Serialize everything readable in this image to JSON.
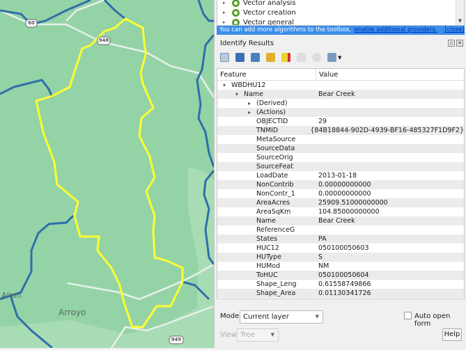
{
  "map": {
    "place_labels": [
      "Alton",
      "Arroyo"
    ],
    "road_shields": [
      "60",
      "948",
      "949"
    ],
    "colors": {
      "land": "#94d3a6",
      "boundary": "#ffff33",
      "river": "#2f6ea8",
      "road": "#e8f0ea"
    }
  },
  "toolbox": {
    "items": [
      "Vector analysis",
      "Vector creation",
      "Vector general"
    ],
    "banner_text": "You can add more algorithms to the toolbox,",
    "banner_link": "enable additional providers.",
    "banner_close": "[close]"
  },
  "identify": {
    "title": "Identify Results",
    "columns": [
      "Feature",
      "Value"
    ],
    "rows": [
      {
        "f": "WBDHU12",
        "v": "",
        "lvl": 0,
        "exp": "▾"
      },
      {
        "f": "Name",
        "v": "Bear Creek",
        "lvl": 1,
        "exp": "▾"
      },
      {
        "f": "(Derived)",
        "v": "",
        "lvl": 2,
        "exp": "▸"
      },
      {
        "f": "(Actions)",
        "v": "",
        "lvl": 2,
        "exp": "▸"
      },
      {
        "f": "OBJECTID",
        "v": "29",
        "lvl": 2,
        "exp": ""
      },
      {
        "f": "TNMID",
        "v": "{84B18844-902D-4939-BF16-485327F1D9F2}",
        "lvl": 2,
        "exp": ""
      },
      {
        "f": "MetaSource",
        "v": "",
        "lvl": 2,
        "exp": ""
      },
      {
        "f": "SourceData",
        "v": "",
        "lvl": 2,
        "exp": ""
      },
      {
        "f": "SourceOrig",
        "v": "",
        "lvl": 2,
        "exp": ""
      },
      {
        "f": "SourceFeat",
        "v": "",
        "lvl": 2,
        "exp": ""
      },
      {
        "f": "LoadDate",
        "v": "2013-01-18",
        "lvl": 2,
        "exp": ""
      },
      {
        "f": "NonContrib",
        "v": "0.00000000000",
        "lvl": 2,
        "exp": ""
      },
      {
        "f": "NonContr_1",
        "v": "0.00000000000",
        "lvl": 2,
        "exp": ""
      },
      {
        "f": "AreaAcres",
        "v": "25909.51000000000",
        "lvl": 2,
        "exp": ""
      },
      {
        "f": "AreaSqKm",
        "v": "104.85000000000",
        "lvl": 2,
        "exp": ""
      },
      {
        "f": "Name",
        "v": "Bear Creek",
        "lvl": 2,
        "exp": ""
      },
      {
        "f": "ReferenceG",
        "v": "",
        "lvl": 2,
        "exp": ""
      },
      {
        "f": "States",
        "v": "PA",
        "lvl": 2,
        "exp": ""
      },
      {
        "f": "HUC12",
        "v": "050100050603",
        "lvl": 2,
        "exp": ""
      },
      {
        "f": "HUType",
        "v": "S",
        "lvl": 2,
        "exp": ""
      },
      {
        "f": "HUMod",
        "v": "NM",
        "lvl": 2,
        "exp": ""
      },
      {
        "f": "ToHUC",
        "v": "050100050604",
        "lvl": 2,
        "exp": ""
      },
      {
        "f": "Shape_Leng",
        "v": "0.61558749866",
        "lvl": 2,
        "exp": ""
      },
      {
        "f": "Shape_Area",
        "v": "0.01130341726",
        "lvl": 2,
        "exp": ""
      }
    ],
    "mode_label": "Mode",
    "mode_value": "Current layer",
    "auto_open_label": "Auto open form",
    "view_label": "View",
    "view_value": "Tree",
    "help_label": "Help"
  }
}
